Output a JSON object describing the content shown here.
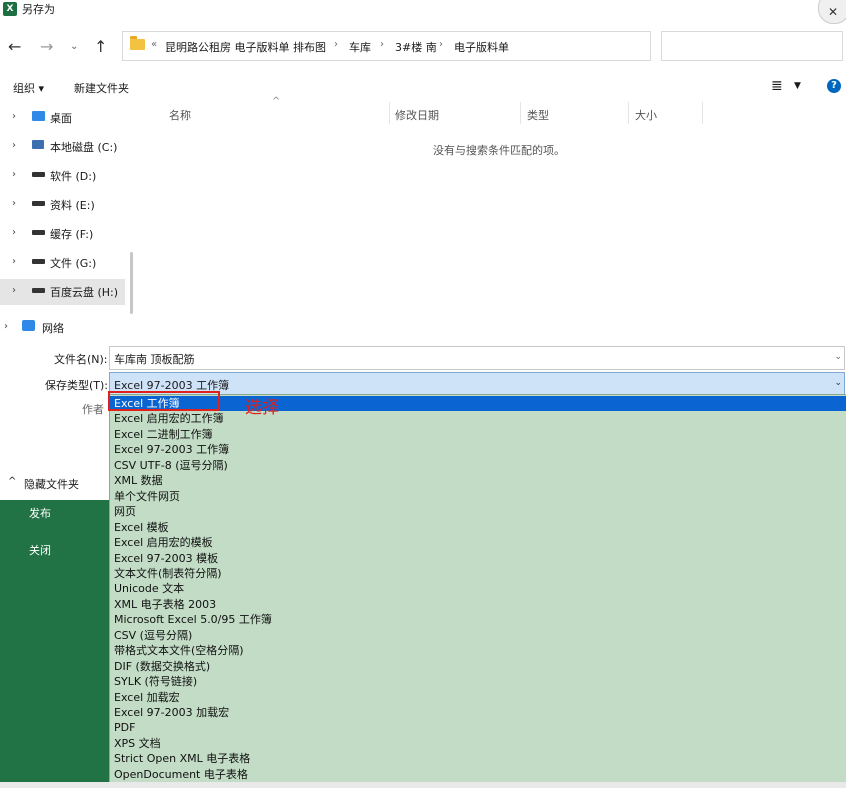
{
  "window": {
    "title": "另存为",
    "app_icon_text": "X"
  },
  "address": {
    "overflow_indicator": "«",
    "crumbs": [
      "昆明路公租房 电子版料单 排布图",
      "车库",
      "3#楼 南",
      "电子版料单"
    ],
    "separator": "›"
  },
  "toolbar": {
    "organize_label": "组织 ▾",
    "new_folder_label": "新建文件夹"
  },
  "nav": {
    "items": [
      {
        "label": "桌面",
        "icon": "desktop-icon"
      },
      {
        "label": "本地磁盘 (C:)",
        "icon": "pc-drive-icon"
      },
      {
        "label": "软件 (D:)",
        "icon": "drive-icon"
      },
      {
        "label": "资料 (E:)",
        "icon": "drive-icon"
      },
      {
        "label": "缓存 (F:)",
        "icon": "drive-icon"
      },
      {
        "label": "文件 (G:)",
        "icon": "drive-icon"
      },
      {
        "label": "百度云盘 (H:)",
        "icon": "drive-icon",
        "selected": true
      },
      {
        "label": "网络",
        "icon": "network-icon"
      }
    ]
  },
  "filelist": {
    "columns": [
      "名称",
      "修改日期",
      "类型",
      "大小"
    ],
    "empty_message": "没有与搜索条件匹配的项。"
  },
  "form": {
    "filename_label": "文件名(N):",
    "filename_value": "车库南 顶板配筋",
    "type_label": "保存类型(T):",
    "type_value": "Excel 97-2003 工作簿",
    "author_label": "作者"
  },
  "hide_folders_label": "隐藏文件夹",
  "backstage": {
    "publish": "发布",
    "close": "关闭"
  },
  "save_types": [
    "Excel 工作簿",
    "Excel 启用宏的工作簿",
    "Excel 二进制工作簿",
    "Excel 97-2003 工作簿",
    "CSV UTF-8 (逗号分隔)",
    "XML 数据",
    "单个文件网页",
    "网页",
    "Excel 模板",
    "Excel 启用宏的模板",
    "Excel 97-2003 模板",
    "文本文件(制表符分隔)",
    "Unicode 文本",
    "XML 电子表格 2003",
    "Microsoft Excel 5.0/95 工作簿",
    "CSV (逗号分隔)",
    "带格式文本文件(空格分隔)",
    "DIF (数据交换格式)",
    "SYLK (符号链接)",
    "Excel 加载宏",
    "Excel 97-2003 加载宏",
    "PDF",
    "XPS 文档",
    "Strict Open XML 电子表格",
    "OpenDocument 电子表格"
  ],
  "selected_save_type": "Excel 工作簿",
  "annotation": "选择",
  "colors": {
    "accent": "#0a64d2",
    "excel_green": "#217346",
    "dropdown_bg": "#c2dcc6",
    "annotation_red": "#e0201b"
  }
}
